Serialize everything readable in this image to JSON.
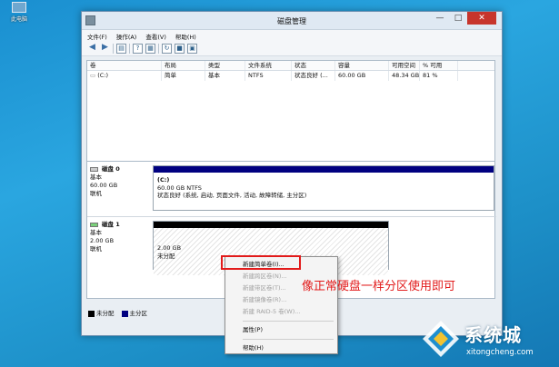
{
  "desktop": {
    "icon_label": "此电脑"
  },
  "window": {
    "title": "磁盘管理",
    "controls": {
      "minimize": "—",
      "maximize": "□",
      "close": "✕"
    }
  },
  "menu": [
    "文件(F)",
    "操作(A)",
    "查看(V)",
    "帮助(H)"
  ],
  "toolbar": [
    "back-arrow",
    "forward-arrow",
    "console-tree",
    "help",
    "properties",
    "refresh",
    "lock",
    "rescan"
  ],
  "volume_table": {
    "columns": [
      "卷",
      "布局",
      "类型",
      "文件系统",
      "状态",
      "容量",
      "可用空间",
      "% 可用"
    ],
    "rows": [
      {
        "volume": "(C:)",
        "layout": "简单",
        "type": "基本",
        "fs": "NTFS",
        "status": "状态良好 (...",
        "capacity": "60.00 GB",
        "free": "48.34 GB",
        "percent": "81 %"
      }
    ]
  },
  "disks": [
    {
      "name": "磁盘 0",
      "type": "基本",
      "size": "60.00 GB",
      "state": "联机",
      "partition": {
        "title": "(C:)",
        "size_fs": "60.00 GB NTFS",
        "status": "状态良好 (系统, 启动, 页面文件, 活动, 故障转储, 主分区)",
        "bar_color": "#000080"
      }
    },
    {
      "name": "磁盘 1",
      "type": "基本",
      "size": "2.00 GB",
      "state": "联机",
      "partition": {
        "size": "2.00 GB",
        "status": "未分配",
        "bar_color": "#000000"
      }
    }
  ],
  "legend": [
    {
      "label": "未分配",
      "color": "#000000"
    },
    {
      "label": "主分区",
      "color": "#000080"
    }
  ],
  "context_menu": [
    {
      "label": "新建简单卷(I)...",
      "enabled": true
    },
    {
      "label": "新建跨区卷(N)...",
      "enabled": false
    },
    {
      "label": "新建带区卷(T)...",
      "enabled": false
    },
    {
      "label": "新建镜像卷(R)...",
      "enabled": false
    },
    {
      "label": "新建 RAID-5 卷(W)...",
      "enabled": false
    },
    {
      "label": "属性(P)",
      "enabled": true
    },
    {
      "label": "帮助(H)",
      "enabled": true
    }
  ],
  "annotation": "像正常硬盘一样分区使用即可",
  "watermark": {
    "name": "系统城",
    "url": "xitongcheng.com"
  },
  "colors": {
    "annotation_red": "#e21b1b",
    "primary_partition": "#000080",
    "desktop_blue": "#1d90c8"
  }
}
